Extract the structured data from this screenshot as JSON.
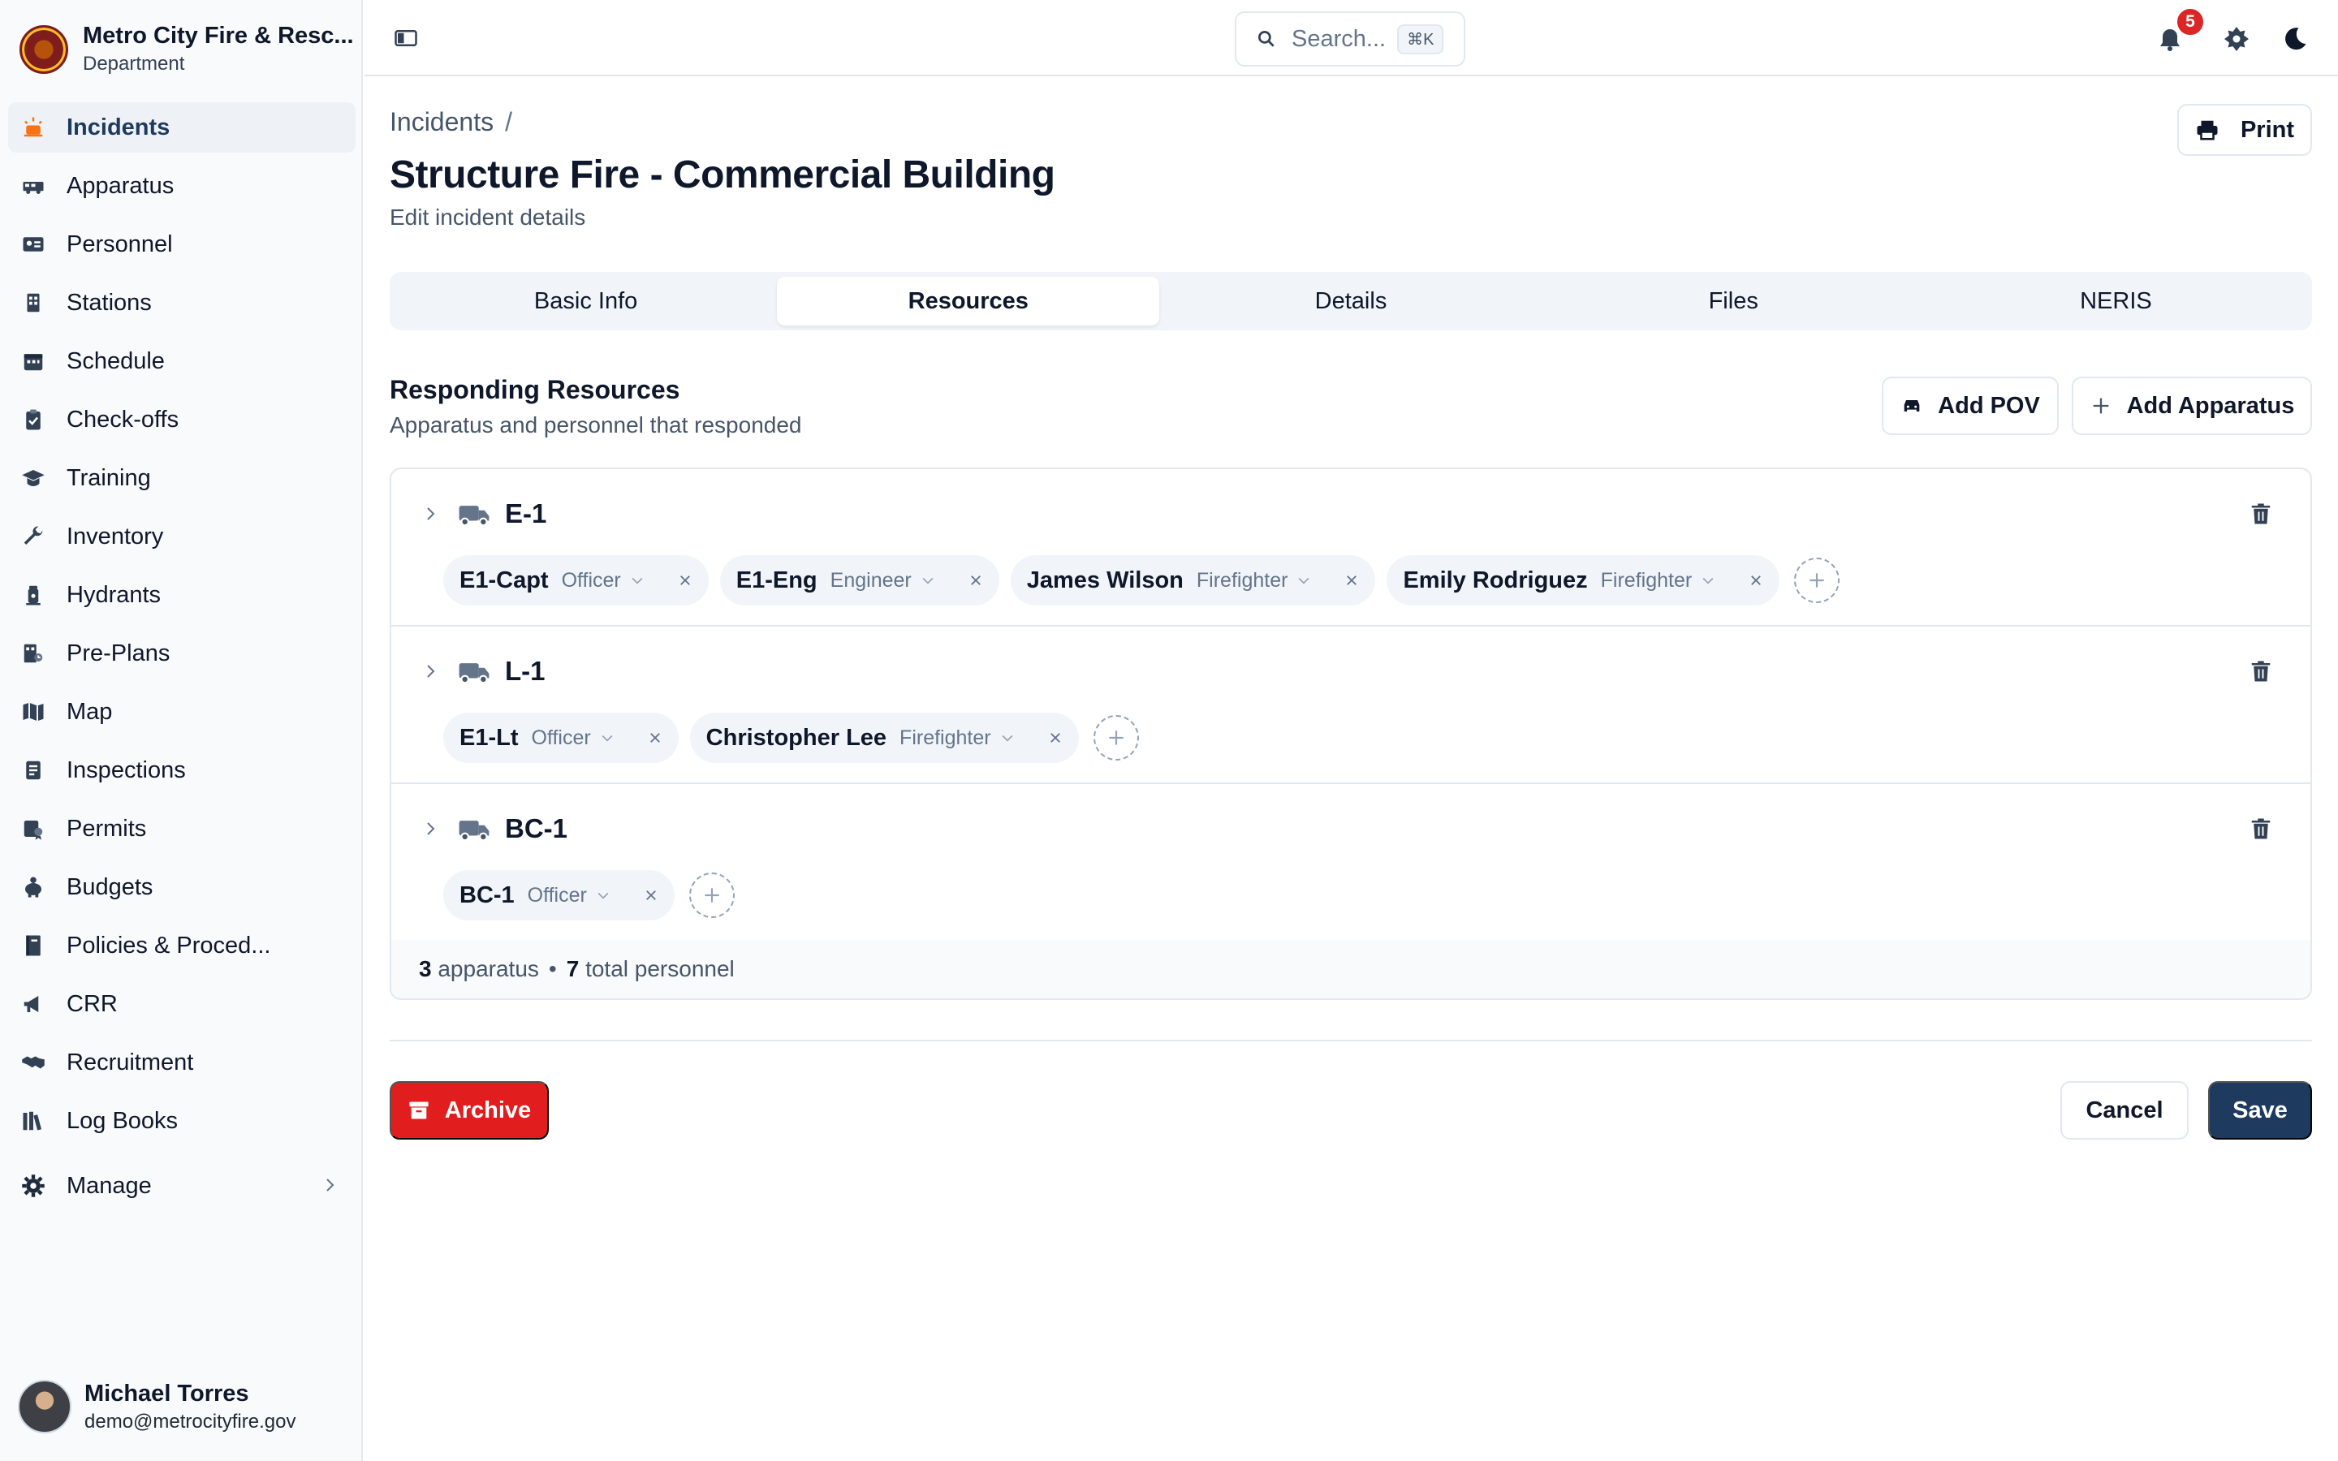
{
  "org": {
    "name": "Metro City Fire & Resc...",
    "sub": "Department"
  },
  "nav": [
    {
      "label": "Incidents",
      "icon": "alarm-light-icon"
    },
    {
      "label": "Apparatus",
      "icon": "fire-truck-icon"
    },
    {
      "label": "Personnel",
      "icon": "id-card-icon"
    },
    {
      "label": "Stations",
      "icon": "building-icon"
    },
    {
      "label": "Schedule",
      "icon": "calendar-icon"
    },
    {
      "label": "Check-offs",
      "icon": "clipboard-check-icon"
    },
    {
      "label": "Training",
      "icon": "graduation-cap-icon"
    },
    {
      "label": "Inventory",
      "icon": "wrench-icon"
    },
    {
      "label": "Hydrants",
      "icon": "hydrant-icon"
    },
    {
      "label": "Pre-Plans",
      "icon": "floor-plan-icon"
    },
    {
      "label": "Map",
      "icon": "map-icon"
    },
    {
      "label": "Inspections",
      "icon": "inspection-icon"
    },
    {
      "label": "Permits",
      "icon": "permit-icon"
    },
    {
      "label": "Budgets",
      "icon": "piggy-bank-icon"
    },
    {
      "label": "Policies & Proced...",
      "icon": "book-icon"
    },
    {
      "label": "CRR",
      "icon": "megaphone-icon"
    },
    {
      "label": "Recruitment",
      "icon": "handshake-icon"
    },
    {
      "label": "Log Books",
      "icon": "books-icon"
    }
  ],
  "manage": {
    "label": "Manage"
  },
  "user": {
    "name": "Michael Torres",
    "email": "demo@metrocityfire.gov"
  },
  "topbar": {
    "search_placeholder": "Search...",
    "search_shortcut": "⌘K",
    "notification_count": "5"
  },
  "breadcrumb": {
    "root": "Incidents",
    "sep": "/"
  },
  "page": {
    "title": "Structure Fire - Commercial Building",
    "subtitle": "Edit incident details",
    "print_label": "Print"
  },
  "tabs": [
    "Basic Info",
    "Resources",
    "Details",
    "Files",
    "NERIS"
  ],
  "active_tab": "Resources",
  "resources": {
    "title": "Responding Resources",
    "subtitle": "Apparatus and personnel that responded",
    "add_pov_label": "Add POV",
    "add_apparatus_label": "Add Apparatus",
    "units": [
      {
        "name": "E-1",
        "crew": [
          {
            "name": "E1-Capt",
            "role": "Officer"
          },
          {
            "name": "E1-Eng",
            "role": "Engineer"
          },
          {
            "name": "James Wilson",
            "role": "Firefighter"
          },
          {
            "name": "Emily Rodriguez",
            "role": "Firefighter"
          }
        ]
      },
      {
        "name": "L-1",
        "crew": [
          {
            "name": "E1-Lt",
            "role": "Officer"
          },
          {
            "name": "Christopher Lee",
            "role": "Firefighter"
          }
        ]
      },
      {
        "name": "BC-1",
        "crew": [
          {
            "name": "BC-1",
            "role": "Officer"
          }
        ]
      }
    ],
    "summary": {
      "apparatus_count": "3",
      "apparatus_label": "apparatus",
      "separator": "•",
      "personnel_count": "7",
      "personnel_label": "total personnel"
    }
  },
  "actions": {
    "archive_label": "Archive",
    "cancel_label": "Cancel",
    "save_label": "Save"
  },
  "colors": {
    "primary": "#1e3a5f",
    "danger": "#e11d1d",
    "badge": "#dc2626"
  }
}
